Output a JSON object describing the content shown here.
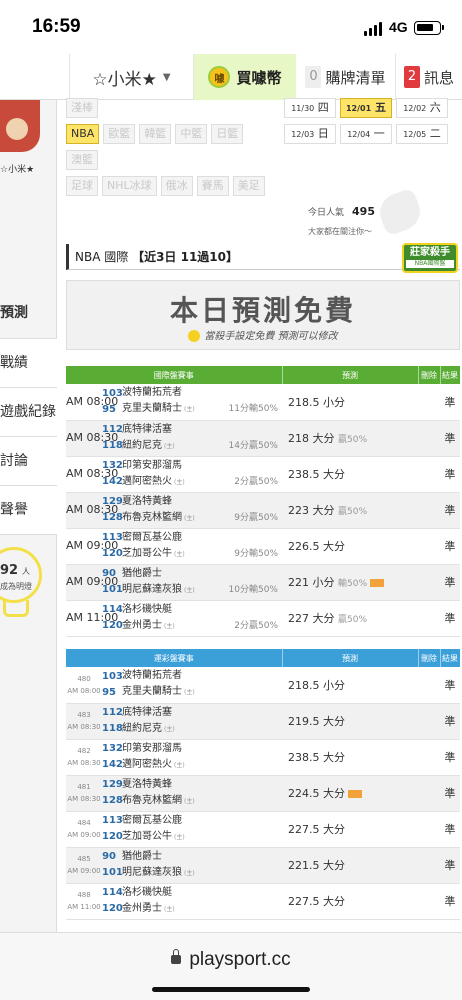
{
  "status": {
    "time": "16:59",
    "network": "4G"
  },
  "nav": {
    "user": "☆小米★",
    "buy": "買噱幣",
    "coin_icon": "噱",
    "cart_count": "0",
    "cart": "購牌清單",
    "msg_count": "2",
    "msg": "訊息"
  },
  "sidebar": {
    "username": "☆小米★",
    "heading": "預測",
    "items": [
      "戰績",
      "遊戲紀錄",
      "討論",
      "聲譽"
    ],
    "followers_count": "92",
    "followers_unit": "人",
    "followers_text": "成為明燈"
  },
  "leagues": {
    "row1": [
      "淺棒"
    ],
    "row2": [
      "NBA",
      "歐籃",
      "韓籃",
      "中籃",
      "日籃"
    ],
    "row3": [
      "澳籃"
    ],
    "row4": [
      "足球",
      "NHL冰球",
      "俄冰",
      "賽馬",
      "美足"
    ],
    "active": "NBA"
  },
  "dates": [
    [
      {
        "d": "11/30",
        "w": "四"
      },
      {
        "d": "12/01",
        "w": "五",
        "active": true
      },
      {
        "d": "12/02",
        "w": "六"
      }
    ],
    [
      {
        "d": "12/03",
        "w": "日"
      },
      {
        "d": "12/04",
        "w": "一"
      },
      {
        "d": "12/05",
        "w": "二"
      }
    ]
  ],
  "popularity": {
    "label": "今日人氣",
    "value": "495",
    "sub": "大家都在關注你～"
  },
  "section": {
    "league": "NBA 國際",
    "range": "【近3日 11過10】"
  },
  "badge": {
    "title": "莊家殺手",
    "sub": "NBA國際盤"
  },
  "banner": {
    "title": "本日預測免費",
    "subtitle": "當殺手設定免費  預測可以修改"
  },
  "intl_table": {
    "headers": [
      "國際盤賽事",
      "預測",
      "刪除",
      "結果"
    ],
    "rows": [
      {
        "time": "AM 08:00",
        "n1": "103",
        "t1": "波特蘭拓荒者",
        "n2": "95",
        "t2": "克里夫蘭騎士",
        "odds": "11分輸50%",
        "pred": "218.5 小分",
        "pct": "",
        "hot": false,
        "result": "準"
      },
      {
        "time": "AM 08:30",
        "n1": "112",
        "t1": "底特律活塞",
        "n2": "118",
        "t2": "紐約尼克",
        "odds": "14分贏50%",
        "pred": "218 大分",
        "pct": "贏50%",
        "hot": false,
        "result": "準"
      },
      {
        "time": "AM 08:30",
        "n1": "132",
        "t1": "印第安那溜馬",
        "n2": "142",
        "t2": "邁阿密熱火",
        "odds": "2分贏50%",
        "pred": "238.5 大分",
        "pct": "",
        "hot": false,
        "result": "準"
      },
      {
        "time": "AM 08:30",
        "n1": "129",
        "t1": "夏洛特黃蜂",
        "n2": "128",
        "t2": "布魯克林籃網",
        "odds": "9分贏50%",
        "pred": "223 大分",
        "pct": "贏50%",
        "hot": false,
        "result": "準"
      },
      {
        "time": "AM 09:00",
        "n1": "113",
        "t1": "密爾瓦基公鹿",
        "n2": "120",
        "t2": "芝加哥公牛",
        "odds": "9分輸50%",
        "pred": "226.5 大分",
        "pct": "",
        "hot": false,
        "result": "準"
      },
      {
        "time": "AM 09:00",
        "n1": "90",
        "t1": "猶他爵士",
        "n2": "101",
        "t2": "明尼蘇達灰狼",
        "odds": "10分輸50%",
        "pred": "221 小分",
        "pct": "輸50%",
        "hot": true,
        "result": "準"
      },
      {
        "time": "AM 11:00",
        "n1": "114",
        "t1": "洛杉磯快艇",
        "n2": "120",
        "t2": "金州勇士",
        "odds": "2分贏50%",
        "pred": "227 大分",
        "pct": "贏50%",
        "hot": false,
        "result": "準"
      }
    ]
  },
  "lottery_table": {
    "headers": [
      "運彩盤賽事",
      "預測",
      "刪除",
      "結果"
    ],
    "rows": [
      {
        "id": "480",
        "time": "AM 08:00",
        "n1": "103",
        "t1": "波特蘭拓荒者",
        "n2": "95",
        "t2": "克里夫蘭騎士",
        "pred": "218.5 小分",
        "hot": false,
        "result": "準"
      },
      {
        "id": "483",
        "time": "AM 08:30",
        "n1": "112",
        "t1": "底特律活塞",
        "n2": "118",
        "t2": "紐約尼克",
        "pred": "219.5 大分",
        "hot": false,
        "result": "準"
      },
      {
        "id": "482",
        "time": "AM 08:30",
        "n1": "132",
        "t1": "印第安那溜馬",
        "n2": "142",
        "t2": "邁阿密熱火",
        "pred": "238.5 大分",
        "hot": false,
        "result": "準"
      },
      {
        "id": "481",
        "time": "AM 08:30",
        "n1": "129",
        "t1": "夏洛特黃蜂",
        "n2": "128",
        "t2": "布魯克林籃網",
        "pred": "224.5 大分",
        "hot": true,
        "result": "準"
      },
      {
        "id": "484",
        "time": "AM 09:00",
        "n1": "113",
        "t1": "密爾瓦基公鹿",
        "n2": "120",
        "t2": "芝加哥公牛",
        "pred": "227.5 大分",
        "hot": false,
        "result": "準"
      },
      {
        "id": "485",
        "time": "AM 09:00",
        "n1": "90",
        "t1": "猶他爵士",
        "n2": "101",
        "t2": "明尼蘇達灰狼",
        "pred": "221.5 大分",
        "hot": false,
        "result": "準"
      },
      {
        "id": "488",
        "time": "AM 11:00",
        "n1": "114",
        "t1": "洛杉磯快艇",
        "n2": "120",
        "t2": "金州勇士",
        "pred": "227.5 大分",
        "hot": false,
        "result": "準"
      }
    ]
  },
  "home_mark": "(主)",
  "url": "playsport.cc"
}
